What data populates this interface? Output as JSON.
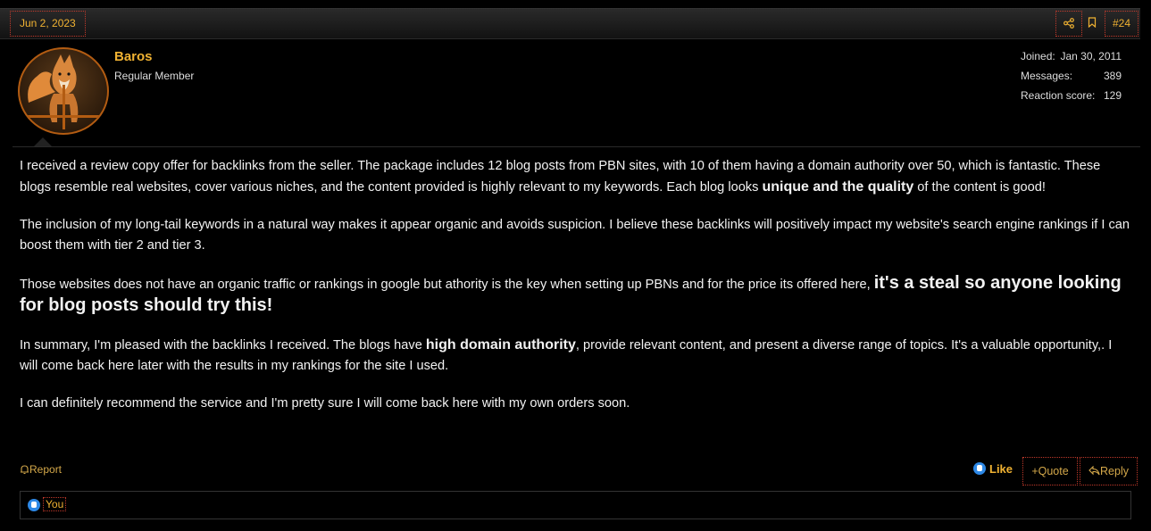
{
  "header": {
    "date": "Jun 2, 2023",
    "post_number": "#24",
    "share_icon": "share-icon",
    "bookmark_icon": "bookmark-icon"
  },
  "user": {
    "name": "Baros",
    "title": "Regular Member",
    "avatar_icon": "fox-avatar",
    "stats": [
      {
        "label": "Joined:",
        "value": "Jan 30, 2011"
      },
      {
        "label": "Messages:",
        "value": "389"
      },
      {
        "label": "Reaction score:",
        "value": "129"
      }
    ]
  },
  "body": {
    "p1_a": "I received a review copy offer for backlinks from the seller. The package includes 12 blog posts from PBN sites, with 10 of them having a domain authority over 50, which is fantastic. These blogs resemble real websites, cover various niches, and the content provided is highly relevant to my keywords. Each blog looks ",
    "p1_b": "unique and the quality",
    "p1_c": " of the content is good!",
    "p2": "The inclusion of my long-tail keywords in a natural way makes it appear organic and avoids suspicion. I believe these backlinks will positively impact my website's search engine rankings if I can boost them with tier 2 and tier 3.",
    "p3_a": "Those websites does not have an organic traffic or rankings in google but athority is the key when setting up PBNs and for the price its offered here, ",
    "p3_b": "it's a steal so anyone looking for blog posts should try this!",
    "p4_a": "In summary, I'm pleased with the backlinks I received. The blogs have ",
    "p4_b": "high domain authority",
    "p4_c": ", provide relevant content, and present a diverse range of topics. It's a valuable opportunity,. I will come back here later with the results in my rankings for the site I used.",
    "p5": "I can definitely recommend the service and I'm pretty sure I will come back here with my own orders soon."
  },
  "actions": {
    "report": "Report",
    "like": "Like",
    "quote": "Quote",
    "reply": "Reply"
  },
  "reactions": {
    "you": "You"
  },
  "colors": {
    "accent": "#f0b232",
    "link": "#d4a84a",
    "like_blue": "#2d88e6"
  }
}
